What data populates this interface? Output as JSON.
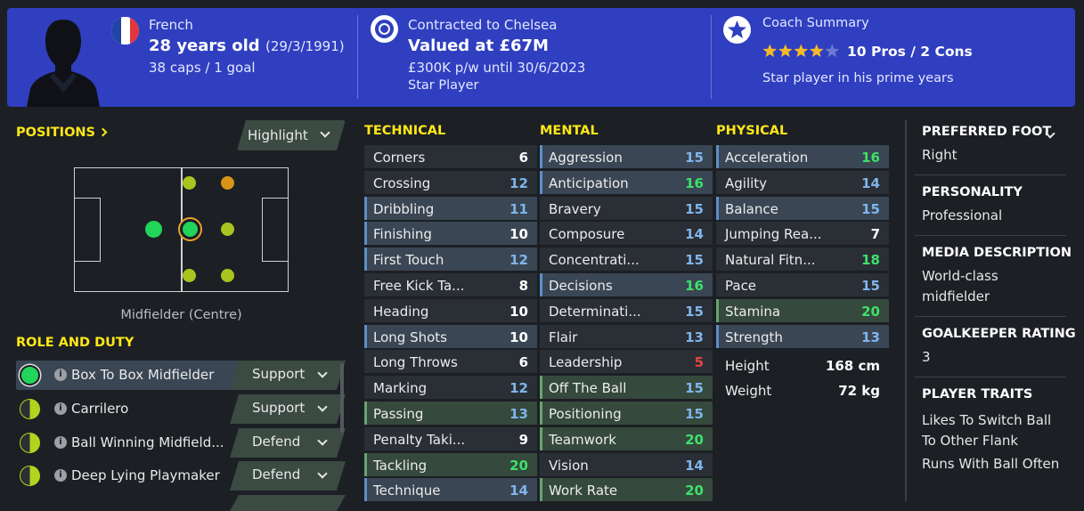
{
  "header": {
    "nationality": "French",
    "age": "28 years old",
    "dob": "(29/3/1991)",
    "caps": "38 caps / 1 goal",
    "contract_status": "Contracted to Chelsea",
    "valuation": "Valued at £67M",
    "wage": "£300K p/w until 30/6/2023",
    "status": "Star Player",
    "coach_title": "Coach Summary",
    "stars": 4,
    "stars_max": 5,
    "pros_cons": "10 Pros / 2 Cons",
    "coach_note": "Star player in his prime years",
    "brand_color": "#2f3fbf"
  },
  "positions": {
    "title": "POSITIONS",
    "highlight_label": "Highlight",
    "caption": "Midfielder (Centre)"
  },
  "roles": {
    "title": "ROLE AND DUTY",
    "items": [
      {
        "name": "Box To Box Midfielder",
        "duty": "Support"
      },
      {
        "name": "Carrilero",
        "duty": "Support"
      },
      {
        "name": "Ball Winning Midfield...",
        "duty": "Defend"
      },
      {
        "name": "Deep Lying Playmaker",
        "duty": "Defend"
      }
    ]
  },
  "technical": {
    "title": "TECHNICAL",
    "items": [
      {
        "name": "Corners",
        "value": "6"
      },
      {
        "name": "Crossing",
        "value": "12"
      },
      {
        "name": "Dribbling",
        "value": "11"
      },
      {
        "name": "Finishing",
        "value": "10"
      },
      {
        "name": "First Touch",
        "value": "12"
      },
      {
        "name": "Free Kick Ta...",
        "value": "8"
      },
      {
        "name": "Heading",
        "value": "10"
      },
      {
        "name": "Long Shots",
        "value": "10"
      },
      {
        "name": "Long Throws",
        "value": "6"
      },
      {
        "name": "Marking",
        "value": "12"
      },
      {
        "name": "Passing",
        "value": "13"
      },
      {
        "name": "Penalty Taki...",
        "value": "9"
      },
      {
        "name": "Tackling",
        "value": "20"
      },
      {
        "name": "Technique",
        "value": "14"
      }
    ]
  },
  "mental": {
    "title": "MENTAL",
    "items": [
      {
        "name": "Aggression",
        "value": "15"
      },
      {
        "name": "Anticipation",
        "value": "16"
      },
      {
        "name": "Bravery",
        "value": "15"
      },
      {
        "name": "Composure",
        "value": "14"
      },
      {
        "name": "Concentrati...",
        "value": "15"
      },
      {
        "name": "Decisions",
        "value": "16"
      },
      {
        "name": "Determinati...",
        "value": "15"
      },
      {
        "name": "Flair",
        "value": "13"
      },
      {
        "name": "Leadership",
        "value": "5"
      },
      {
        "name": "Off The Ball",
        "value": "15"
      },
      {
        "name": "Positioning",
        "value": "15"
      },
      {
        "name": "Teamwork",
        "value": "20"
      },
      {
        "name": "Vision",
        "value": "14"
      },
      {
        "name": "Work Rate",
        "value": "20"
      }
    ]
  },
  "physical": {
    "title": "PHYSICAL",
    "items": [
      {
        "name": "Acceleration",
        "value": "16"
      },
      {
        "name": "Agility",
        "value": "14"
      },
      {
        "name": "Balance",
        "value": "15"
      },
      {
        "name": "Jumping Rea...",
        "value": "7"
      },
      {
        "name": "Natural Fitn...",
        "value": "18"
      },
      {
        "name": "Pace",
        "value": "15"
      },
      {
        "name": "Stamina",
        "value": "20"
      },
      {
        "name": "Strength",
        "value": "13"
      }
    ],
    "height_label": "Height",
    "height_value": "168 cm",
    "weight_label": "Weight",
    "weight_value": "72 kg"
  },
  "details": {
    "foot_title": "PREFERRED FOOT",
    "foot_value": "Right",
    "personality_title": "PERSONALITY",
    "personality_value": "Professional",
    "media_title": "MEDIA DESCRIPTION",
    "media_line1": "World-class",
    "media_line2": "midfielder",
    "gk_title": "GOALKEEPER RATING",
    "gk_value": "3",
    "traits_title": "PLAYER TRAITS",
    "trait1_line1": "Likes To Switch Ball",
    "trait1_line2": "To Other Flank",
    "trait2": "Runs With Ball Often"
  },
  "colors": {
    "accent_yellow": "#ffe817",
    "green_high": "#3ee06a",
    "blue_value": "#7fb5ec",
    "red_low": "#e8453c",
    "white_value": "#ffffff"
  }
}
